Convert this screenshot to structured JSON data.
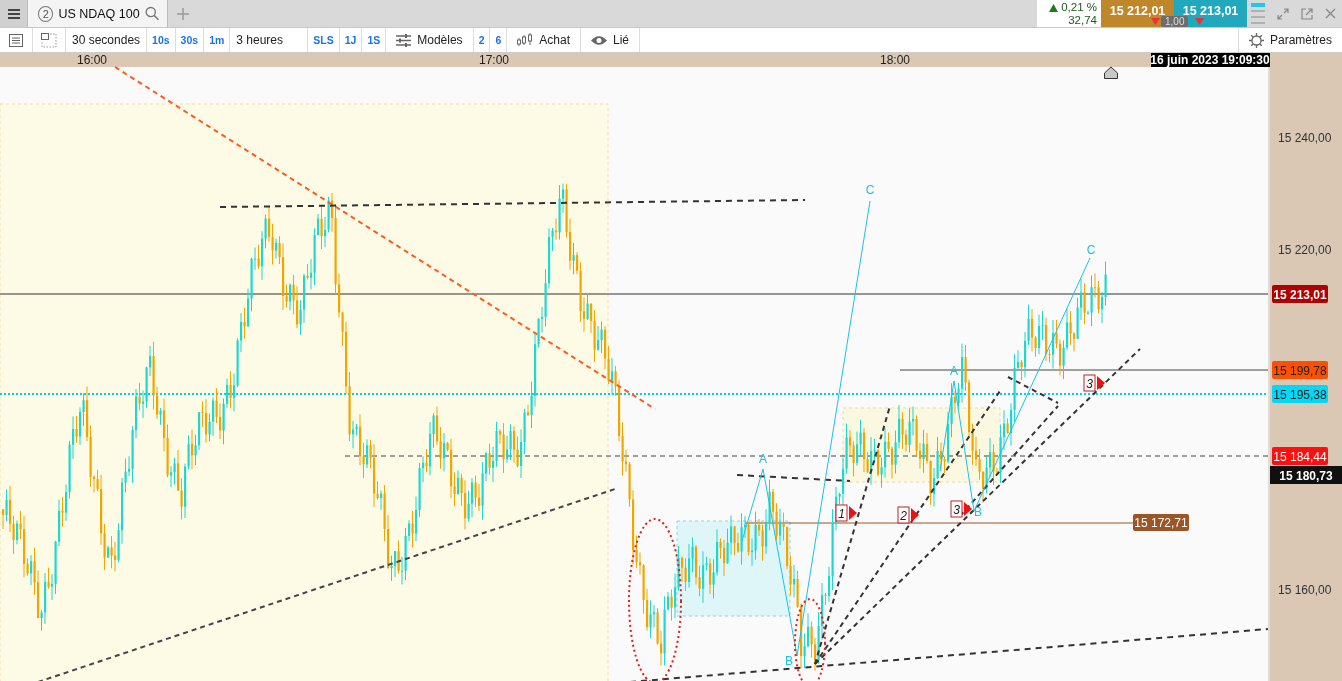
{
  "header": {
    "tab": {
      "number": "2",
      "title": "US NDAQ 100"
    },
    "quote": {
      "rising": true,
      "change": "0,21 %",
      "points": "32,74",
      "sell": "15 212,01",
      "buy": "15 213,01",
      "spread": "1,00"
    }
  },
  "toolbar": {
    "items": [
      {
        "label": "30 secondes",
        "kind": "select"
      },
      {
        "label": "10s",
        "kind": "shortcut"
      },
      {
        "label": "30s",
        "kind": "shortcut"
      },
      {
        "label": "1m",
        "kind": "shortcut"
      },
      {
        "label": "3 heures",
        "kind": "select"
      },
      {
        "label": "SLS",
        "kind": "shortcut"
      },
      {
        "label": "1J",
        "kind": "shortcut"
      },
      {
        "label": "1S",
        "kind": "shortcut"
      },
      {
        "label": "Modèles",
        "kind": "templates"
      },
      {
        "label": "2",
        "kind": "shortcut"
      },
      {
        "label": "6",
        "kind": "shortcut"
      },
      {
        "label": "Achat",
        "kind": "order"
      },
      {
        "label": "Lié",
        "kind": "link"
      }
    ],
    "settings": "Paramètres"
  },
  "chart": {
    "time_labels": [
      "16:00",
      "17:00",
      "18:00"
    ],
    "cursor_time": "16 juin 2023 19:09:30",
    "price_ticks": [
      "15 240,00",
      "15 220,00",
      "15 160,00"
    ],
    "price_markers": [
      {
        "text": "15 213,01",
        "color": "#b00000"
      },
      {
        "text": "15 199,78",
        "color": "#ff5000"
      },
      {
        "text": "15 195,38",
        "color": "#00d8f8"
      },
      {
        "text": "15 184,44",
        "color": "#ff1010"
      },
      {
        "text": "15 180,73",
        "color": "#101010"
      }
    ],
    "level_tag": {
      "text": "15 172,71",
      "color": "#9c5526"
    },
    "wave_labels": [
      {
        "text": "C"
      },
      {
        "text": "C"
      },
      {
        "text": "A"
      },
      {
        "text": "A"
      },
      {
        "text": "B"
      },
      {
        "text": "B"
      }
    ],
    "order_markers": [
      {
        "text": "1"
      },
      {
        "text": "2"
      },
      {
        "text": "3"
      },
      {
        "text": "3"
      }
    ]
  }
}
